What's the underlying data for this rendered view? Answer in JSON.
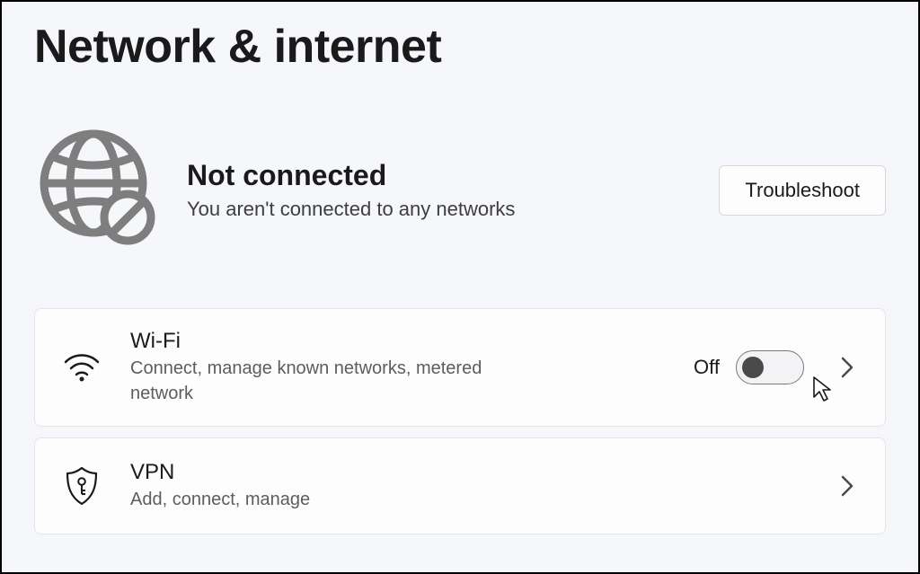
{
  "page": {
    "title": "Network & internet"
  },
  "status": {
    "title": "Not connected",
    "subtitle": "You aren't connected to any networks",
    "troubleshoot_label": "Troubleshoot"
  },
  "wifi": {
    "title": "Wi-Fi",
    "subtitle": "Connect, manage known networks, metered network",
    "toggle_state_label": "Off",
    "toggle_on": false
  },
  "vpn": {
    "title": "VPN",
    "subtitle": "Add, connect, manage"
  }
}
